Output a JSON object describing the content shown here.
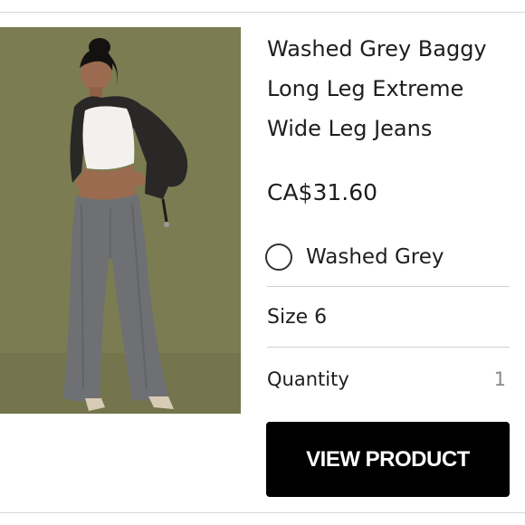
{
  "product": {
    "title": "Washed Grey Baggy Long Leg Extreme Wide Leg Jeans",
    "price": "CA$31.60",
    "color": "Washed Grey",
    "size": "Size 6",
    "quantity_label": "Quantity",
    "quantity_value": "1"
  },
  "actions": {
    "view_product": "VIEW PRODUCT"
  },
  "colors": {
    "image_background": "#7b7c52",
    "button_background": "#000000",
    "button_text": "#ffffff"
  }
}
